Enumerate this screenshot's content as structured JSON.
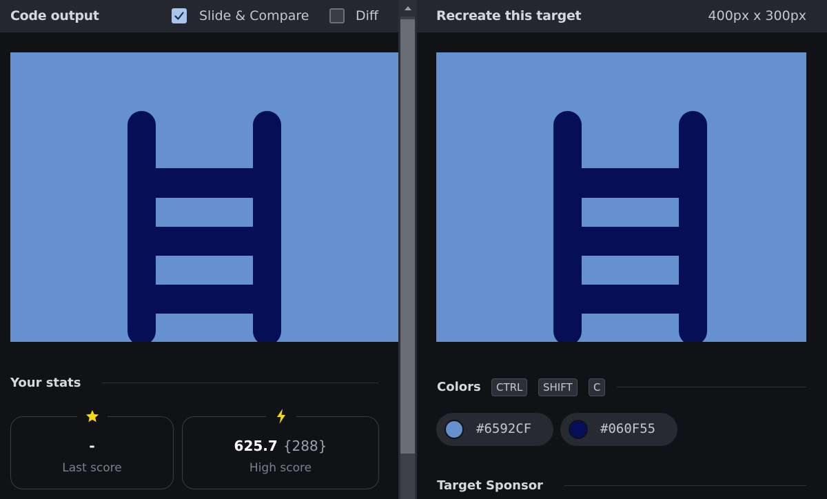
{
  "left_panel": {
    "title": "Code output",
    "slide_compare": {
      "label": "Slide & Compare",
      "checked": true
    },
    "diff": {
      "label": "Diff",
      "checked": false
    },
    "stats": {
      "title": "Your stats",
      "last": {
        "icon": "star-icon",
        "value": "-",
        "label": "Last score"
      },
      "high": {
        "icon": "lightning-icon",
        "value": "625.7",
        "extra": "{288}",
        "label": "High score"
      }
    }
  },
  "right_panel": {
    "title": "Recreate this target",
    "dimensions": "400px x 300px",
    "colors": {
      "title": "Colors",
      "shortcut": [
        "CTRL",
        "SHIFT",
        "C"
      ],
      "swatches": [
        {
          "hex": "#6592CF"
        },
        {
          "hex": "#060F55"
        }
      ]
    },
    "sponsor_title": "Target Sponsor"
  },
  "palette": {
    "background": "#6592cf",
    "ladder": "#060f55",
    "accent_star": "#f5d90a"
  }
}
